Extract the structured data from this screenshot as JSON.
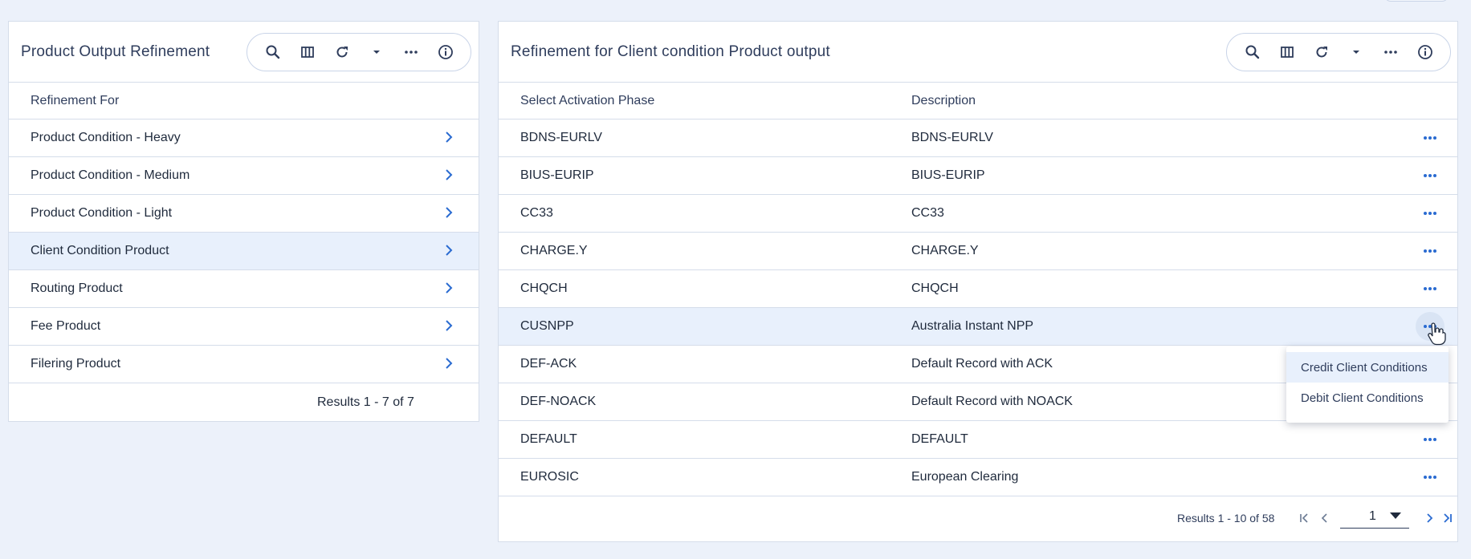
{
  "left_panel": {
    "title": "Product Output Refinement",
    "column_header": "Refinement For",
    "items": [
      {
        "label": "Product Condition - Heavy"
      },
      {
        "label": "Product Condition - Medium"
      },
      {
        "label": "Product Condition - Light"
      },
      {
        "label": "Client Condition Product",
        "selected": true
      },
      {
        "label": "Routing Product"
      },
      {
        "label": "Fee Product"
      },
      {
        "label": "Filering Product"
      }
    ],
    "results": "Results 1 - 7 of 7"
  },
  "right_panel": {
    "title": "Refinement for Client condition Product output",
    "columns": [
      "Select Activation Phase",
      "Description"
    ],
    "rows": [
      {
        "phase": "BDNS-EURLV",
        "description": "BDNS-EURLV"
      },
      {
        "phase": "BIUS-EURIP",
        "description": "BIUS-EURIP"
      },
      {
        "phase": "CC33",
        "description": "CC33"
      },
      {
        "phase": "CHARGE.Y",
        "description": "CHARGE.Y"
      },
      {
        "phase": "CHQCH",
        "description": "CHQCH"
      },
      {
        "phase": "CUSNPP",
        "description": "Australia Instant NPP",
        "selected": true
      },
      {
        "phase": "DEF-ACK",
        "description": "Default Record with ACK"
      },
      {
        "phase": "DEF-NOACK",
        "description": "Default Record with NOACK"
      },
      {
        "phase": "DEFAULT",
        "description": "DEFAULT"
      },
      {
        "phase": "EUROSIC",
        "description": "European Clearing"
      }
    ],
    "results": "Results 1 - 10 of 58",
    "page": "1"
  },
  "context_menu": {
    "items": [
      "Credit Client Conditions",
      "Debit Client Conditions"
    ]
  },
  "toolbar_icons": [
    "search-icon",
    "columns-icon",
    "refresh-icon",
    "caret-down-icon",
    "more-icon",
    "info-icon"
  ],
  "colors": {
    "accent": "#2a6bd1",
    "selected_row": "#e8f0fc",
    "background": "#ecf1fa"
  }
}
